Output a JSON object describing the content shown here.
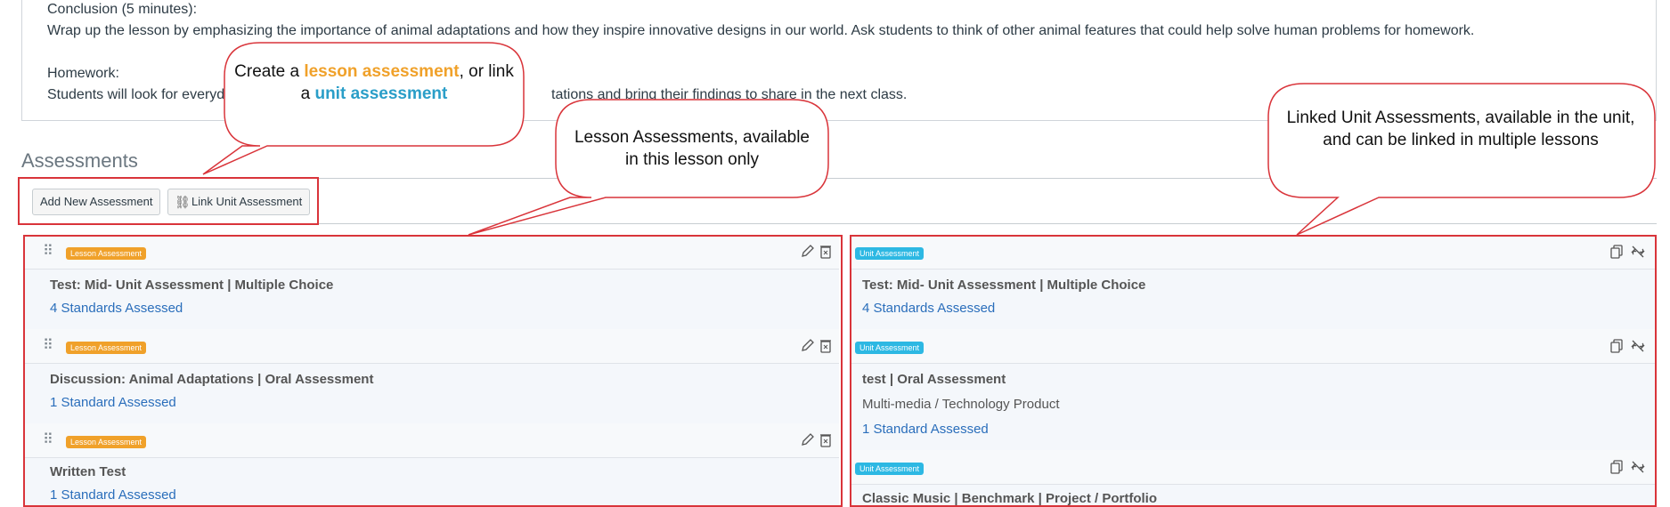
{
  "lesson": {
    "conclusion_heading": "Conclusion (5 minutes):",
    "conclusion_text": "Wrap up the lesson by emphasizing the importance of animal adaptations and how they inspire innovative designs in our world. Ask students to think of other animal features that could help solve human problems for homework.",
    "homework_heading": "Homework:",
    "homework_text_left": "Students will look for everyda",
    "homework_text_right": "tations and bring their findings to share in the next class."
  },
  "assessments": {
    "title": "Assessments",
    "add_button": "Add New Assessment",
    "link_button": "Link Unit Assessment"
  },
  "lesson_assessments": [
    {
      "badge": "Lesson Assessment",
      "title": "Test: Mid- Unit Assessment | Multiple Choice",
      "link": "4 Standards Assessed"
    },
    {
      "badge": "Lesson Assessment",
      "title": "Discussion: Animal Adaptations | Oral Assessment",
      "link": "1 Standard Assessed"
    },
    {
      "badge": "Lesson Assessment",
      "title": "Written Test",
      "link": "1 Standard Assessed"
    }
  ],
  "unit_assessments": [
    {
      "badge": "Unit Assessment",
      "title": "Test: Mid- Unit Assessment | Multiple Choice",
      "link": "4 Standards Assessed"
    },
    {
      "badge": "Unit Assessment",
      "title": "test | Oral Assessment",
      "sub": "Multi-media / Technology Product",
      "link": "1 Standard Assessed"
    },
    {
      "badge": "Unit Assessment",
      "title": "Classic Music | Benchmark | Project / Portfolio"
    }
  ],
  "callouts": {
    "create": {
      "pre": "Create a ",
      "lesson_word": "lesson assessment",
      "mid": ", or link a ",
      "unit_word": "unit assessment"
    },
    "lesson_only": "Lesson Assessments, available in this lesson only",
    "linked_unit": "Linked Unit Assessments, available in the unit, and can be linked in multiple lessons"
  },
  "colors": {
    "accent_red": "#d9343a",
    "lesson_badge": "#f0a12a",
    "unit_badge": "#2db8e3",
    "link_blue": "#2a6ebb"
  }
}
